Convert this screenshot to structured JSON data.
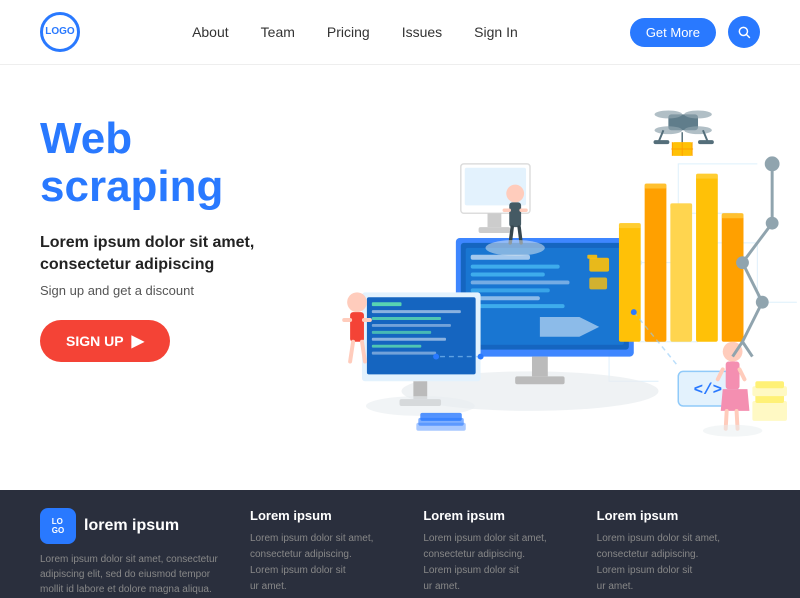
{
  "header": {
    "logo_text": "LO\nGO",
    "nav": [
      {
        "label": "About",
        "id": "nav-about"
      },
      {
        "label": "Team",
        "id": "nav-team"
      },
      {
        "label": "Pricing",
        "id": "nav-pricing"
      },
      {
        "label": "Issues",
        "id": "nav-issues"
      },
      {
        "label": "Sign In",
        "id": "nav-signin"
      }
    ],
    "btn_get_more": "Get More",
    "search_icon": "🔍"
  },
  "hero": {
    "title_line1": "Web",
    "title_line2": "scraping",
    "subtitle": "Lorem ipsum dolor sit amet,\nconsectetur adipiscing",
    "desc": "Sign up and get a discount",
    "btn_signup": "SIGN UP"
  },
  "footer": {
    "logo_text": "LO\nGO",
    "brand_name": "lorem ipsum",
    "brand_desc": "Lorem ipsum dolor sit amet, consectetur\nadipiscing elit, sed do eiusmod tempor\nmollit id labore et dolore magna aliqua.",
    "cols": [
      {
        "title": "Lorem ipsum",
        "lines": [
          "Lorem ipsum dolor sit amet,",
          "consectetur adipiscing.",
          "Lorem ipsum dolor sit",
          "ur amet."
        ]
      },
      {
        "title": "Lorem ipsum",
        "lines": [
          "Lorem ipsum dolor sit amet,",
          "consectetur adipiscing.",
          "Lorem ipsum dolor sit",
          "ur amet."
        ]
      },
      {
        "title": "Lorem ipsum",
        "lines": [
          "Lorem ipsum dolor sit amet,",
          "consectetur adipiscing.",
          "Lorem ipsum dolor sit",
          "ur amet."
        ]
      }
    ]
  }
}
